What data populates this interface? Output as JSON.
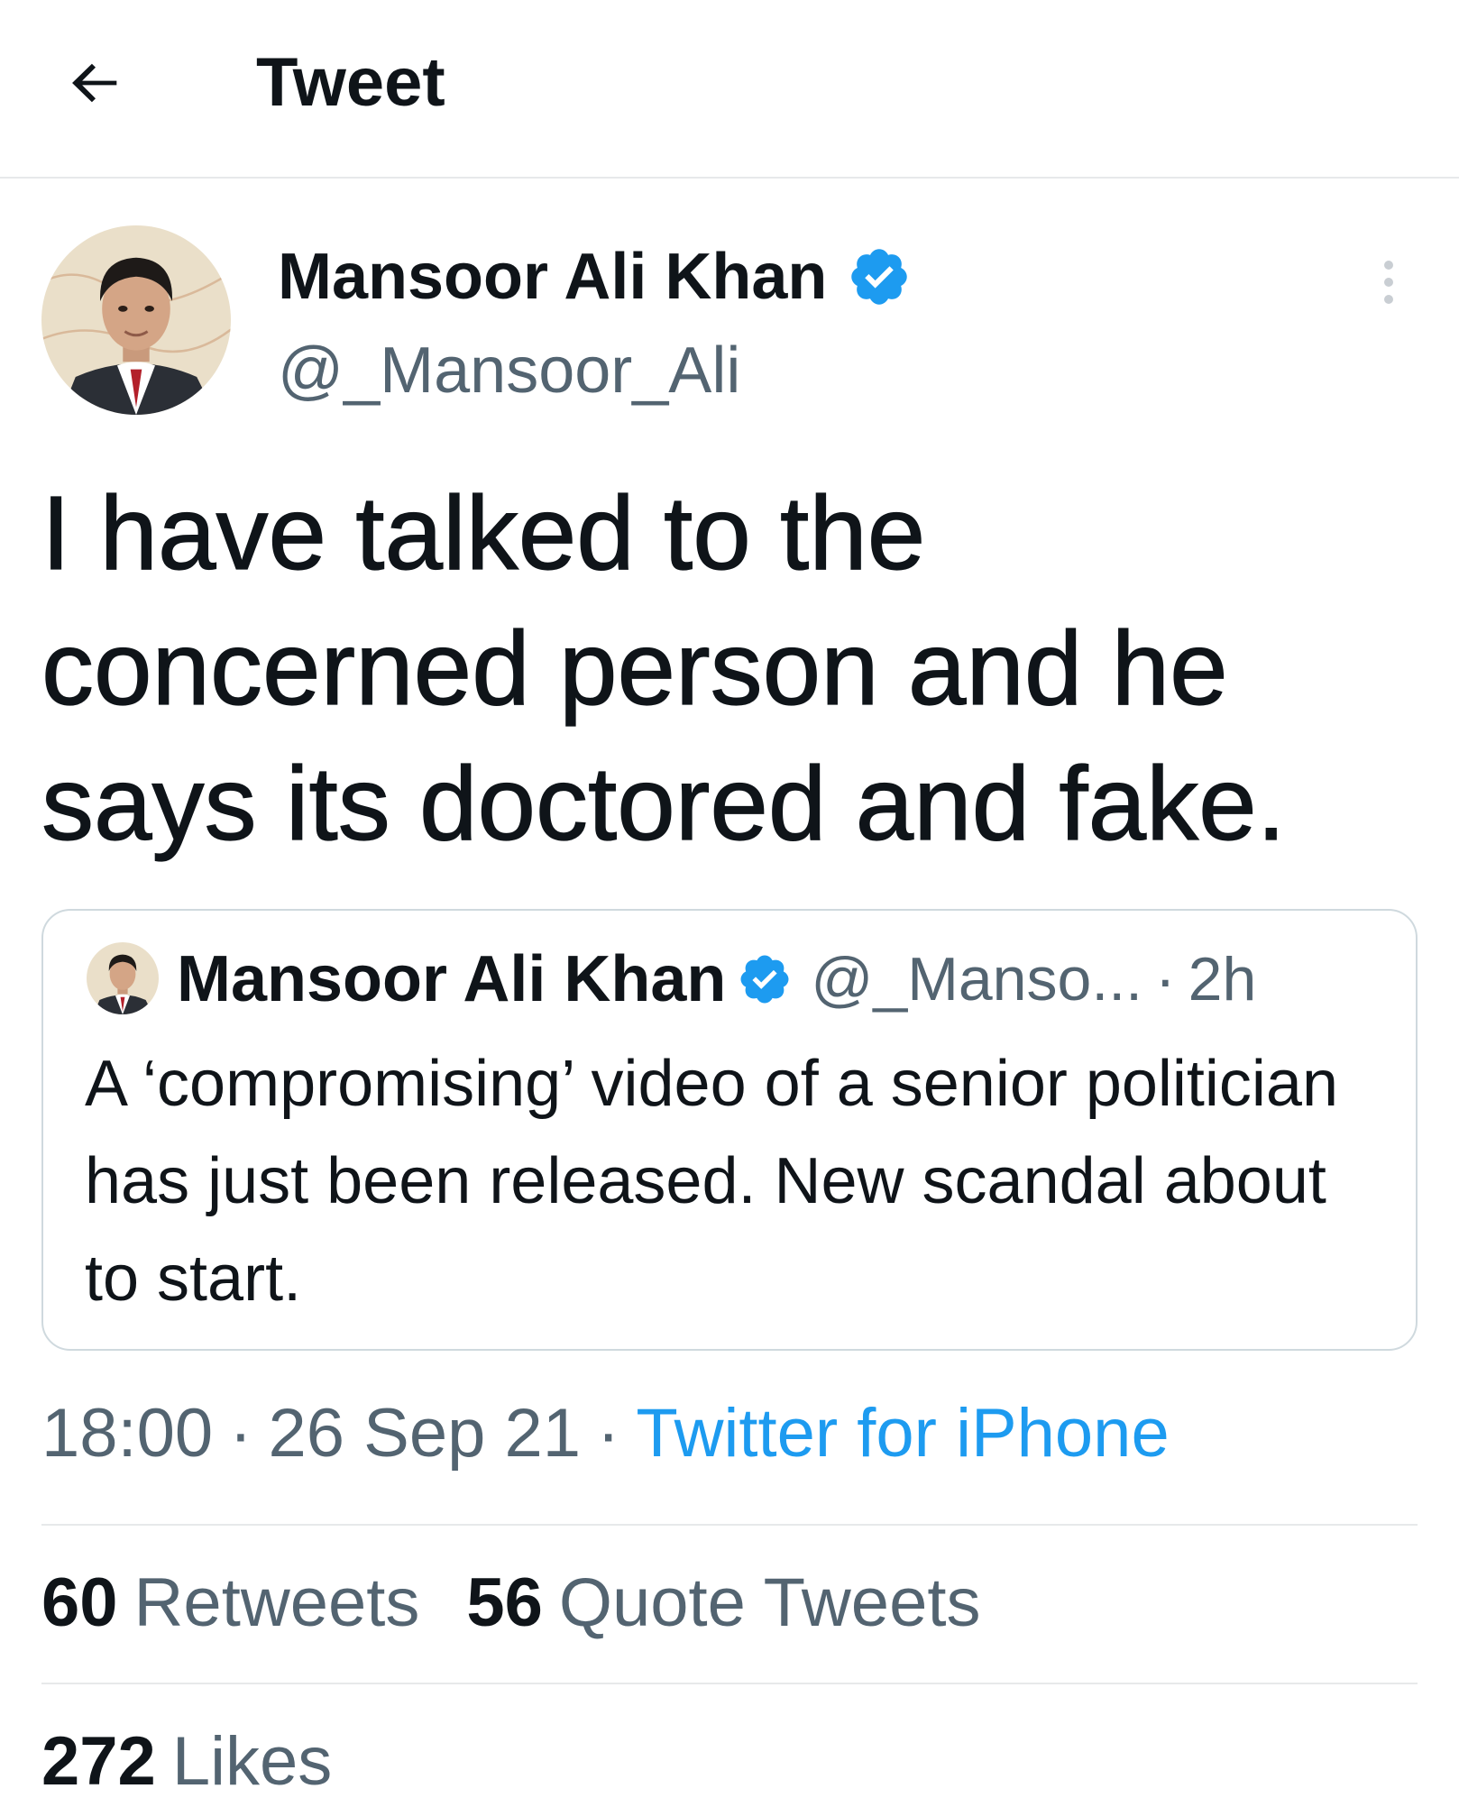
{
  "header": {
    "title": "Tweet",
    "back_icon": "arrow-left-icon"
  },
  "tweet": {
    "author": {
      "name": "Mansoor Ali Khan",
      "handle": "@_Mansoor_Ali",
      "verified": true
    },
    "text": "I have talked to the concerned person and he says its doctored and fake.",
    "quoted": {
      "author_name": "Mansoor Ali Khan",
      "handle": "@_Manso...",
      "separator": "·",
      "time": "2h",
      "text": "A ‘compromising’ video of a senior politician has just been released. New scandal about to start."
    },
    "meta": {
      "time": "18:00",
      "date": "26 Sep 21",
      "separator": "·",
      "source": "Twitter for iPhone"
    },
    "stats": {
      "retweets_count": "60",
      "retweets_label": "Retweets",
      "quotes_count": "56",
      "quotes_label": "Quote Tweets",
      "likes_count": "272",
      "likes_label": "Likes"
    }
  },
  "colors": {
    "text_primary": "#0f1419",
    "text_secondary": "#536471",
    "accent": "#1d9bf0",
    "border": "#cfd9de",
    "divider": "#e7e9ea"
  }
}
